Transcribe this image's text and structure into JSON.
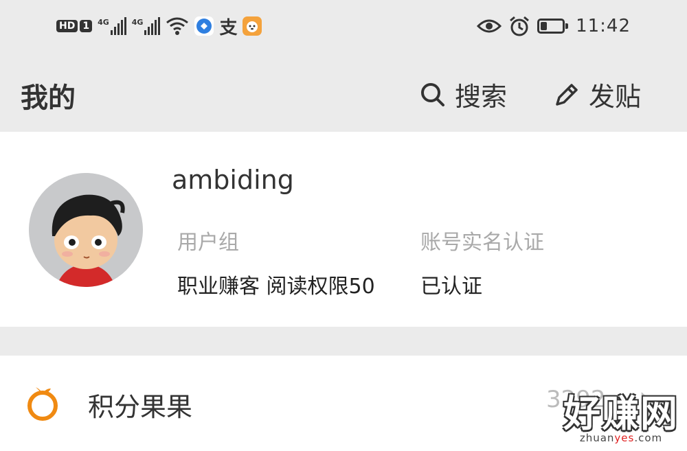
{
  "status_bar": {
    "hd_badge": "HD",
    "sim_badge": "1",
    "network1": "4G",
    "network2": "4G",
    "alipay_icon": "支",
    "time": "11:42",
    "battery_level": 0.3
  },
  "header": {
    "title": "我的",
    "search_label": "搜索",
    "post_label": "发贴"
  },
  "profile": {
    "username": "ambiding",
    "group_label": "用户组",
    "group_value": "职业赚客 阅读权限50",
    "verify_label": "账号实名认证",
    "verify_value": "已认证"
  },
  "list": {
    "points_label": "积分果果",
    "points_value": "3292"
  },
  "watermark": {
    "main": "好赚网",
    "sub_prefix": "zhuan",
    "sub_highlight": "yes",
    "sub_suffix": ".com"
  },
  "colors": {
    "accent_orange": "#f08a12",
    "background": "#ebebeb"
  }
}
